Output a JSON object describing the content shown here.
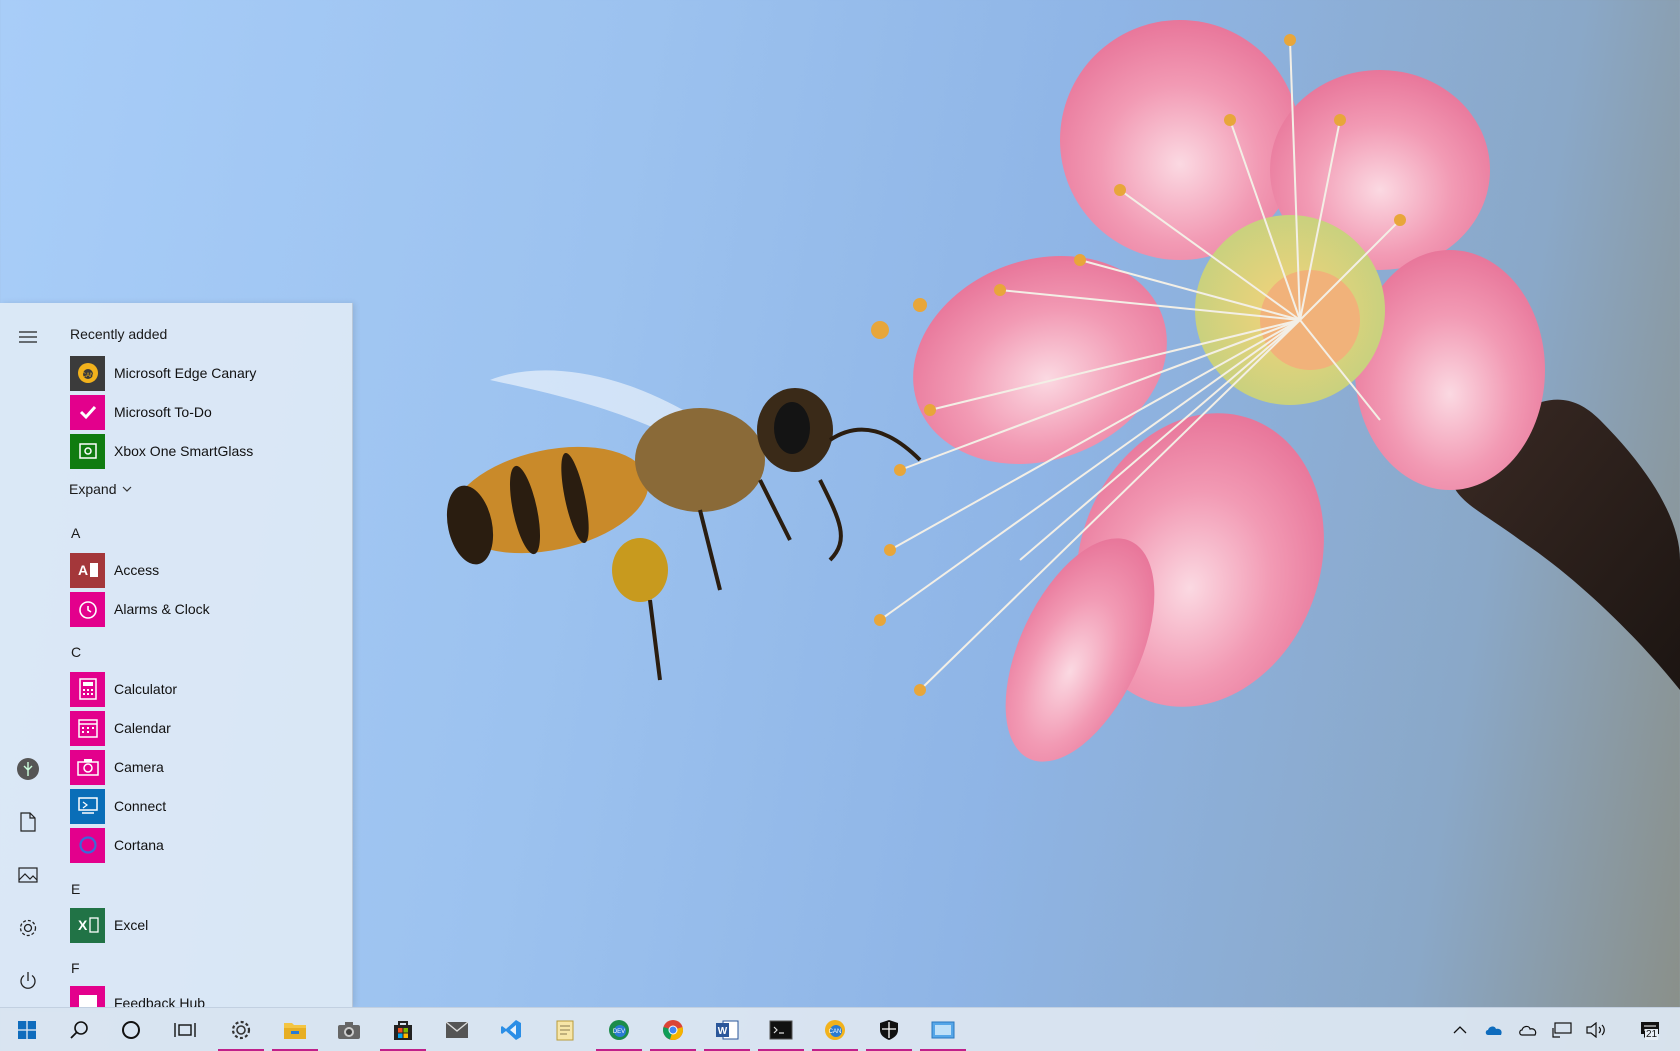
{
  "start_menu": {
    "recently_added_title": "Recently added",
    "recent": [
      {
        "label": "Microsoft Edge Canary",
        "icon": "edge-canary-icon",
        "color": "#3b3b3b"
      },
      {
        "label": "Microsoft To-Do",
        "icon": "check-icon",
        "color": "#e3008c"
      },
      {
        "label": "Xbox One SmartGlass",
        "icon": "smartglass-icon",
        "color": "#107c10"
      }
    ],
    "expand_label": "Expand",
    "groups": [
      {
        "letter": "A",
        "apps": [
          {
            "label": "Access",
            "icon": "access-icon",
            "color": "#a4373a"
          },
          {
            "label": "Alarms & Clock",
            "icon": "alarm-clock-icon",
            "color": "#e3008c"
          }
        ]
      },
      {
        "letter": "C",
        "apps": [
          {
            "label": "Calculator",
            "icon": "calculator-icon",
            "color": "#e3008c"
          },
          {
            "label": "Calendar",
            "icon": "calendar-icon",
            "color": "#e3008c"
          },
          {
            "label": "Camera",
            "icon": "camera-icon",
            "color": "#e3008c"
          },
          {
            "label": "Connect",
            "icon": "connect-icon",
            "color": "#0a6eb8"
          },
          {
            "label": "Cortana",
            "icon": "cortana-icon",
            "color": "#e3008c"
          }
        ]
      },
      {
        "letter": "E",
        "apps": [
          {
            "label": "Excel",
            "icon": "excel-icon",
            "color": "#217346"
          }
        ]
      },
      {
        "letter": "F",
        "apps": [
          {
            "label": "Feedback Hub",
            "icon": "feedback-icon",
            "color": "#e3008c"
          }
        ]
      }
    ],
    "rail": [
      "hamburger-menu-icon",
      "user-avatar-icon",
      "documents-icon",
      "pictures-icon",
      "settings-icon",
      "power-icon"
    ]
  },
  "taskbar": {
    "pinned": [
      "start-icon",
      "search-icon",
      "cortana-icon",
      "task-view-icon",
      "settings-icon",
      "file-explorer-icon",
      "camera-icon",
      "store-icon",
      "mail-icon",
      "vscode-icon",
      "notepad-icon",
      "edge-dev-icon",
      "chrome-icon",
      "word-icon",
      "terminal-icon",
      "edge-canary-icon",
      "defender-icon",
      "remote-desktop-icon"
    ],
    "tray": [
      "show-hidden-icons",
      "onedrive-icon",
      "onedrive-personal-icon",
      "network-icon",
      "volume-icon",
      "action-center-icon"
    ],
    "notification_count": "21"
  },
  "colors": {
    "accent": "#e3008c",
    "running_indicator": "#c0208a"
  }
}
